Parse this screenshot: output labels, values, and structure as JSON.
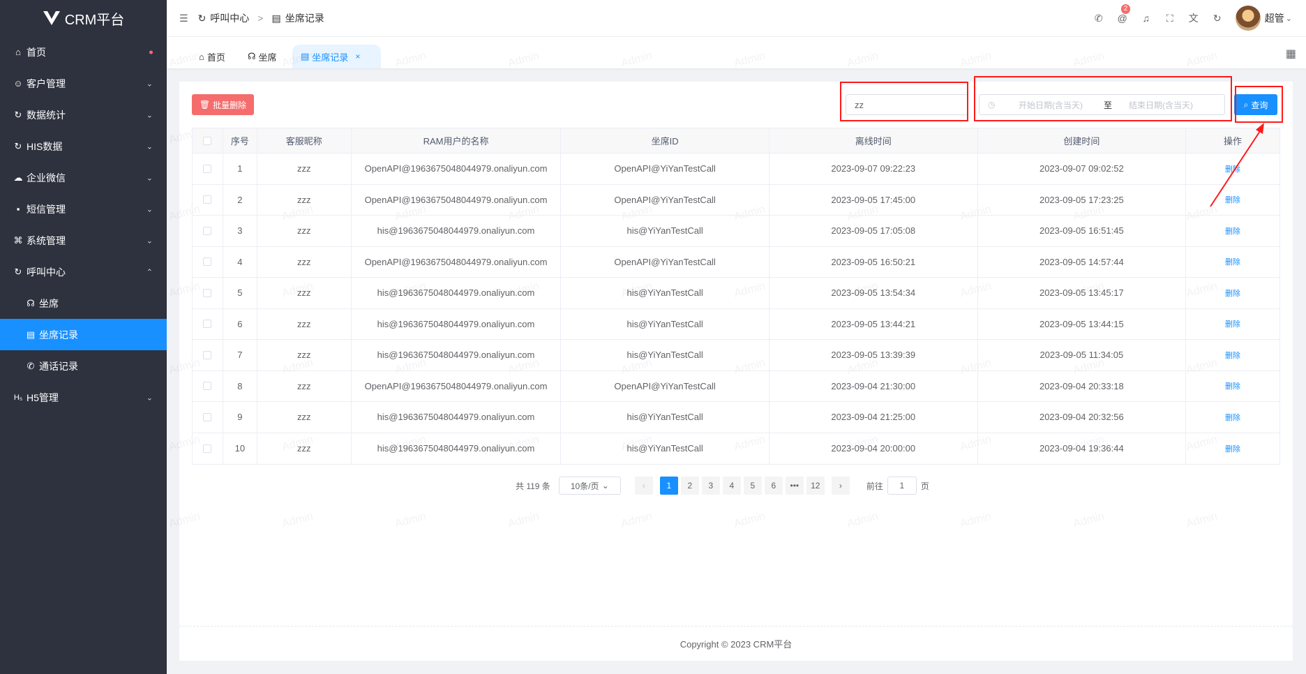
{
  "app": {
    "title": "CRM平台"
  },
  "sidebar": {
    "items": [
      {
        "label": "首页",
        "icon": "home-icon"
      },
      {
        "label": "客户管理",
        "icon": "user-icon"
      },
      {
        "label": "数据统计",
        "icon": "chart-icon"
      },
      {
        "label": "HIS数据",
        "icon": "data-icon"
      },
      {
        "label": "企业微信",
        "icon": "wechat-icon"
      },
      {
        "label": "短信管理",
        "icon": "message-icon"
      },
      {
        "label": "系统管理",
        "icon": "command-icon"
      },
      {
        "label": "呼叫中心",
        "icon": "headset-icon"
      },
      {
        "label": "H5管理",
        "icon": "h5-icon"
      }
    ],
    "submenu": [
      {
        "label": "坐席"
      },
      {
        "label": "坐席记录"
      },
      {
        "label": "通话记录"
      }
    ]
  },
  "header": {
    "breadcrumb": [
      "呼叫中心",
      "坐席记录"
    ],
    "breadcrumb_sep": ">",
    "notification_count": "2",
    "user_name": "超管"
  },
  "tabs": [
    {
      "label": "首页"
    },
    {
      "label": "坐席"
    },
    {
      "label": "坐席记录",
      "close": "×"
    }
  ],
  "toolbar": {
    "batch_delete_label": "批量删除",
    "search_value": "zz",
    "date_start_placeholder": "开始日期(含当天)",
    "date_to": "至",
    "date_end_placeholder": "结束日期(含当天)",
    "query_label": "查询"
  },
  "table": {
    "headers": [
      "序号",
      "客服昵称",
      "RAM用户的名称",
      "坐席ID",
      "离线时间",
      "创建时间",
      "操作"
    ],
    "action_label": "删除",
    "rows": [
      {
        "no": "1",
        "nick": "zzz",
        "ram": "OpenAPI@1963675048044979.onaliyun.com",
        "seat": "OpenAPI@YiYanTestCall",
        "offline": "2023-09-07 09:22:23",
        "created": "2023-09-07 09:02:52"
      },
      {
        "no": "2",
        "nick": "zzz",
        "ram": "OpenAPI@1963675048044979.onaliyun.com",
        "seat": "OpenAPI@YiYanTestCall",
        "offline": "2023-09-05 17:45:00",
        "created": "2023-09-05 17:23:25"
      },
      {
        "no": "3",
        "nick": "zzz",
        "ram": "his@1963675048044979.onaliyun.com",
        "seat": "his@YiYanTestCall",
        "offline": "2023-09-05 17:05:08",
        "created": "2023-09-05 16:51:45"
      },
      {
        "no": "4",
        "nick": "zzz",
        "ram": "OpenAPI@1963675048044979.onaliyun.com",
        "seat": "OpenAPI@YiYanTestCall",
        "offline": "2023-09-05 16:50:21",
        "created": "2023-09-05 14:57:44"
      },
      {
        "no": "5",
        "nick": "zzz",
        "ram": "his@1963675048044979.onaliyun.com",
        "seat": "his@YiYanTestCall",
        "offline": "2023-09-05 13:54:34",
        "created": "2023-09-05 13:45:17"
      },
      {
        "no": "6",
        "nick": "zzz",
        "ram": "his@1963675048044979.onaliyun.com",
        "seat": "his@YiYanTestCall",
        "offline": "2023-09-05 13:44:21",
        "created": "2023-09-05 13:44:15"
      },
      {
        "no": "7",
        "nick": "zzz",
        "ram": "his@1963675048044979.onaliyun.com",
        "seat": "his@YiYanTestCall",
        "offline": "2023-09-05 13:39:39",
        "created": "2023-09-05 11:34:05"
      },
      {
        "no": "8",
        "nick": "zzz",
        "ram": "OpenAPI@1963675048044979.onaliyun.com",
        "seat": "OpenAPI@YiYanTestCall",
        "offline": "2023-09-04 21:30:00",
        "created": "2023-09-04 20:33:18"
      },
      {
        "no": "9",
        "nick": "zzz",
        "ram": "his@1963675048044979.onaliyun.com",
        "seat": "his@YiYanTestCall",
        "offline": "2023-09-04 21:25:00",
        "created": "2023-09-04 20:32:56"
      },
      {
        "no": "10",
        "nick": "zzz",
        "ram": "his@1963675048044979.onaliyun.com",
        "seat": "his@YiYanTestCall",
        "offline": "2023-09-04 20:00:00",
        "created": "2023-09-04 19:36:44"
      }
    ]
  },
  "pagination": {
    "total": "共 119 条",
    "page_size": "10条/页",
    "pages": [
      "1",
      "2",
      "3",
      "4",
      "5",
      "6",
      "•••",
      "12"
    ],
    "current": "1",
    "goto_prefix": "前往",
    "goto_value": "1",
    "goto_suffix": "页"
  },
  "footer": {
    "text": "Copyright ©  2023 CRM平台"
  },
  "watermark": "Admin",
  "colors": {
    "primary": "#1890ff",
    "danger": "#f56c6c",
    "sidebar": "#2d323e",
    "annotation": "#ff1a1a"
  }
}
